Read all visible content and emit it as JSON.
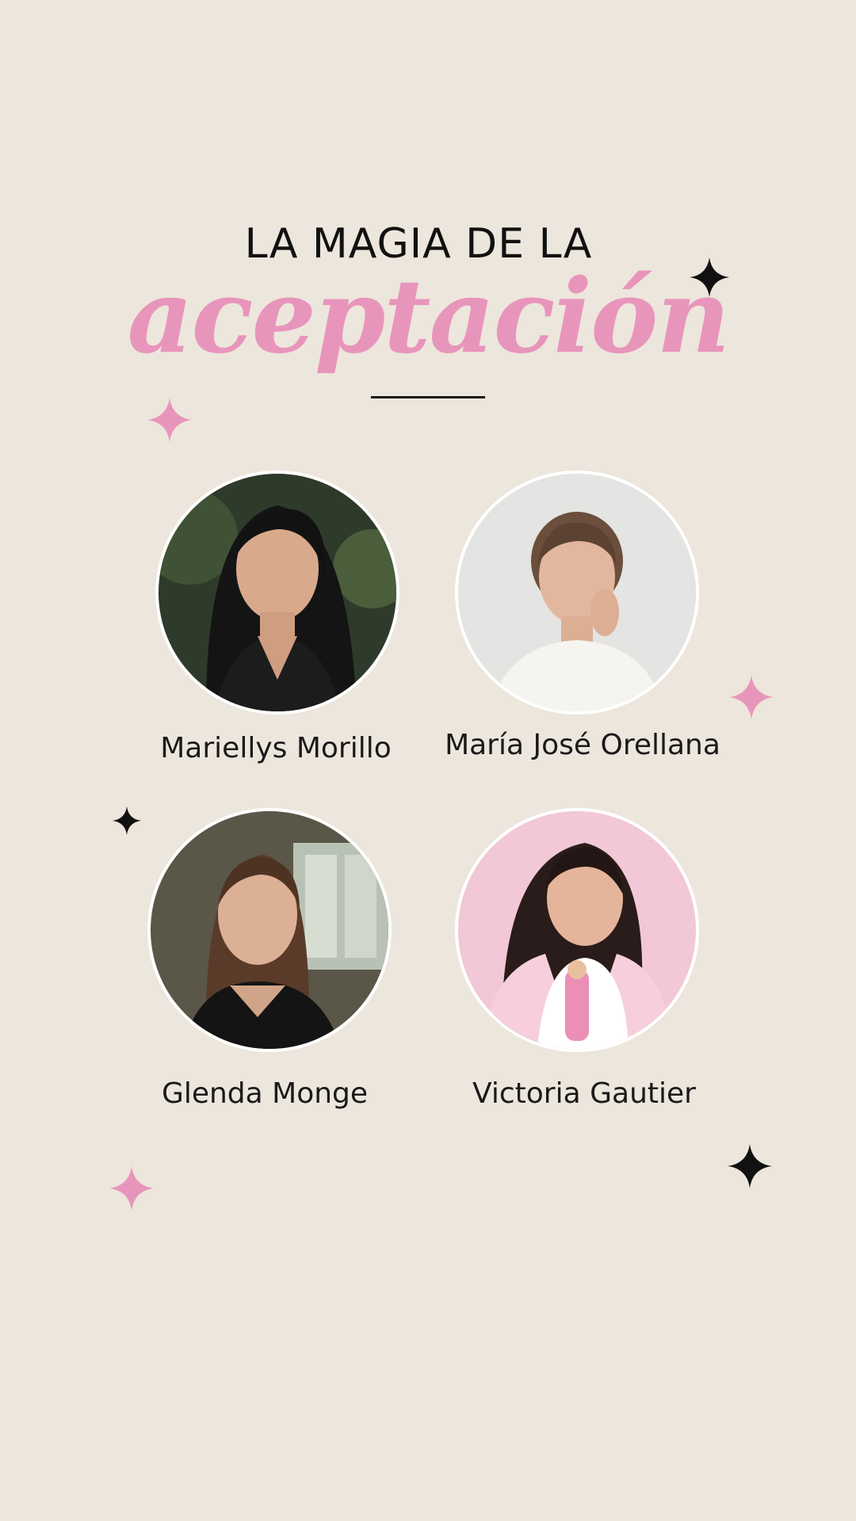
{
  "header": {
    "line1": "LA MAGIA DE LA",
    "line2": "aceptación"
  },
  "people": [
    {
      "name": "Mariellys Morillo",
      "photo": "portrait-photo"
    },
    {
      "name": "María José Orellana",
      "photo": "portrait-photo"
    },
    {
      "name": "Glenda Monge",
      "photo": "portrait-photo"
    },
    {
      "name": "Victoria Gautier",
      "photo": "portrait-photo"
    }
  ],
  "decor": {
    "sparkle_icon": "four-point-star-icon",
    "pink": "#e895bc",
    "black": "#111111",
    "background": "#ede6dc"
  }
}
